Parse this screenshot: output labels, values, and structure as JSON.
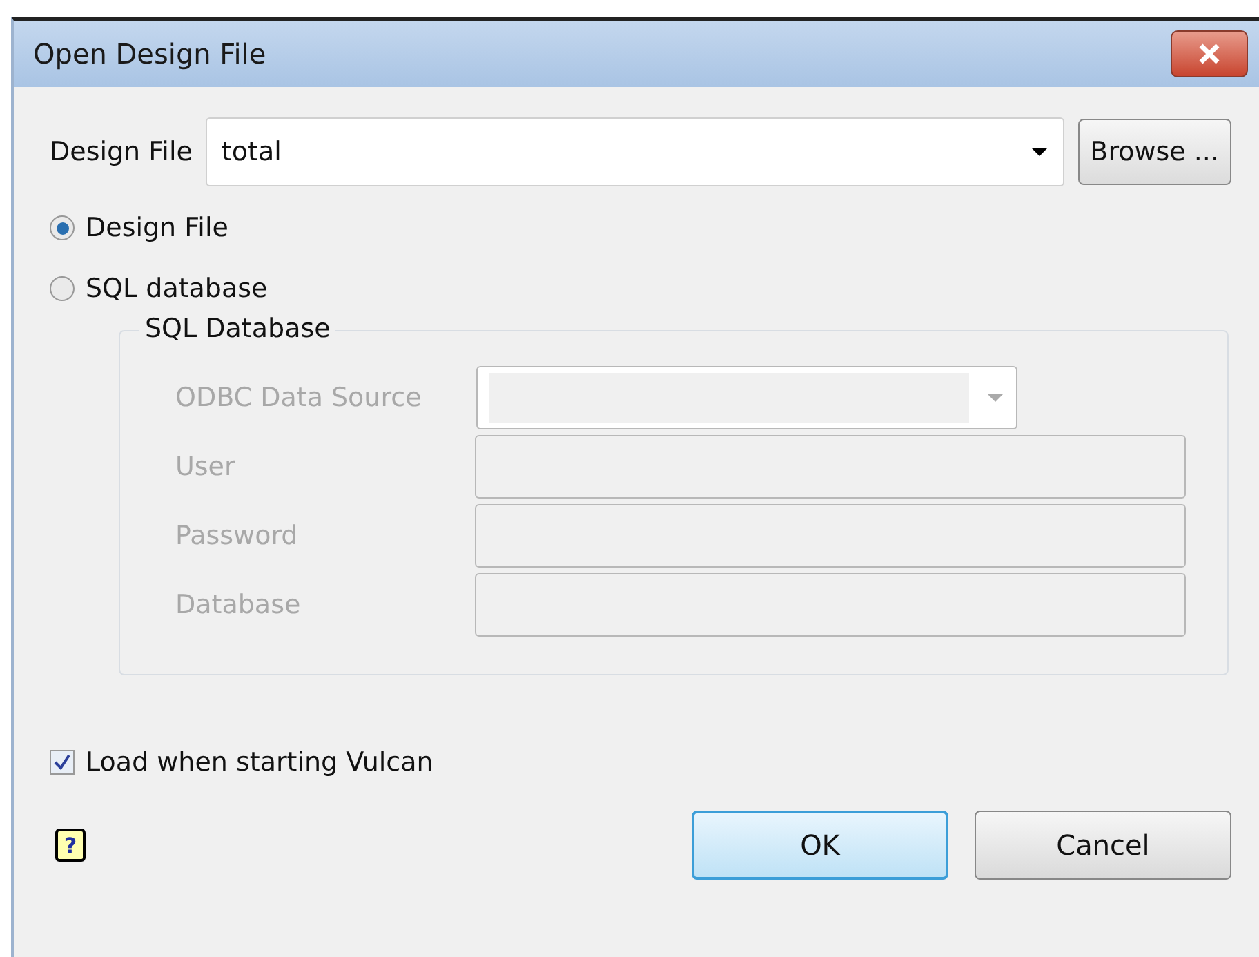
{
  "window": {
    "title": "Open Design File"
  },
  "design_file": {
    "label": "Design File",
    "value": "total"
  },
  "browse_button": "Browse ...",
  "sources": [
    {
      "label": "Design File",
      "selected": true
    },
    {
      "label": "SQL database",
      "selected": false
    }
  ],
  "sql_group": {
    "title": "SQL Database",
    "disabled": true,
    "fields": [
      {
        "label": "ODBC Data Source",
        "kind": "combo"
      },
      {
        "label": "User",
        "kind": "text"
      },
      {
        "label": "Password",
        "kind": "text"
      },
      {
        "label": "Database",
        "kind": "text"
      }
    ]
  },
  "load_checkbox": {
    "label": "Load when starting Vulcan",
    "checked": true
  },
  "help": "?",
  "buttons": [
    {
      "label": "OK",
      "default": true
    },
    {
      "label": "Cancel",
      "default": false
    }
  ]
}
